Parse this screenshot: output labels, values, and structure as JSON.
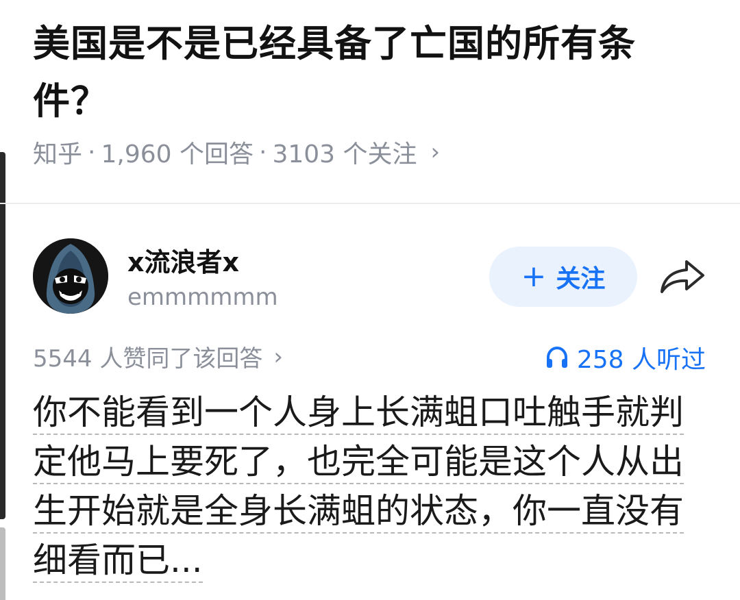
{
  "question": {
    "title": "美国是不是已经具备了亡国的所有条件？",
    "source": "知乎",
    "separator": "·",
    "answers": "1,960 个回答",
    "followers": "3103 个关注",
    "chevron": "›"
  },
  "answer": {
    "author_name": "x流浪者x",
    "author_bio": "emmmmmm",
    "follow_label": "关注",
    "follow_plus": "+",
    "votes_text": "5544 人赞同了该回答",
    "votes_chevron": "›",
    "listen_text": "258 人听过",
    "content": "你不能看到一个人身上长满蛆口吐触手就判定他马上要死了，也完全可能是这个人从出生开始就是全身长满蛆的状态，你一直没有细看而已..."
  },
  "icons": {
    "share": "share-icon",
    "headphones": "headphones-icon",
    "avatar": "avatar-image"
  },
  "colors": {
    "accent": "#1772f6",
    "follow_bg": "#eaf2fd",
    "muted": "#8a8f99"
  }
}
